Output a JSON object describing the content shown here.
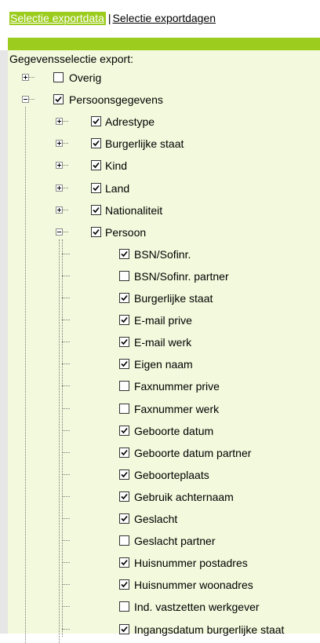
{
  "tabs": {
    "active": "Selectie exportdata",
    "separator": "|",
    "other": "Selectie exportdagen"
  },
  "panel": {
    "title": "Gegevensselectie export:"
  },
  "colors": {
    "accent": "#9ccc1e",
    "panel_bg": "#f2f9dc"
  },
  "tree": {
    "overig": {
      "label": "Overig",
      "checked": false,
      "expanded": false
    },
    "persoonsgegevens": {
      "label": "Persoonsgegevens",
      "checked": true,
      "expanded": true
    },
    "groups": [
      {
        "label": "Adrestype",
        "checked": true,
        "expanded": false
      },
      {
        "label": "Burgerlijke staat",
        "checked": true,
        "expanded": false
      },
      {
        "label": "Kind",
        "checked": true,
        "expanded": false
      },
      {
        "label": "Land",
        "checked": true,
        "expanded": false
      },
      {
        "label": "Nationaliteit",
        "checked": true,
        "expanded": false
      },
      {
        "label": "Persoon",
        "checked": true,
        "expanded": true
      }
    ],
    "persoon_fields": [
      {
        "label": "BSN/Sofinr.",
        "checked": true
      },
      {
        "label": "BSN/Sofinr. partner",
        "checked": false
      },
      {
        "label": "Burgerlijke staat",
        "checked": true
      },
      {
        "label": "E-mail prive",
        "checked": true
      },
      {
        "label": "E-mail werk",
        "checked": true
      },
      {
        "label": "Eigen naam",
        "checked": true
      },
      {
        "label": "Faxnummer prive",
        "checked": false
      },
      {
        "label": "Faxnummer werk",
        "checked": false
      },
      {
        "label": "Geboorte datum",
        "checked": true
      },
      {
        "label": "Geboorte datum partner",
        "checked": true
      },
      {
        "label": "Geboorteplaats",
        "checked": true
      },
      {
        "label": "Gebruik achternaam",
        "checked": true
      },
      {
        "label": "Geslacht",
        "checked": true
      },
      {
        "label": "Geslacht partner",
        "checked": false
      },
      {
        "label": "Huisnummer postadres",
        "checked": true
      },
      {
        "label": "Huisnummer woonadres",
        "checked": true
      },
      {
        "label": "Ind. vastzetten werkgever",
        "checked": false
      },
      {
        "label": "Ingangsdatum burgerlijke staat",
        "checked": true
      }
    ]
  }
}
